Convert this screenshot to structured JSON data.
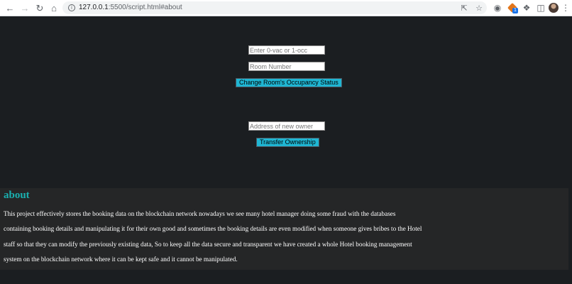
{
  "browser": {
    "url_host": "127.0.0.1",
    "url_rest": ":5500/script.html#about",
    "extension_badge": "1"
  },
  "occupancy_form": {
    "status_placeholder": "Enter 0-vac or 1-occ",
    "room_placeholder": "Room Number",
    "submit_label": "Change Room's Occupancy Status"
  },
  "ownership_form": {
    "address_placeholder": "Address of new owner",
    "submit_label": "Transfer Ownership"
  },
  "about": {
    "heading": "about",
    "text": "This project effectively stores the booking data on the blockchain network nowadays we see many hotel manager doing some fraud with the databases containing booking details and manipulating it for their own good and sometimes the booking details are even modified when someone gives bribes to the Hotel staff so that they can modify the previously existing data, So to keep all the data secure and transparent we have created a whole Hotel booking management system on the blockchain network where it can be kept safe and it cannot be manipulated."
  },
  "colors": {
    "page_background": "#1b1e21",
    "button": "#1fb6d3",
    "about_background": "#252627",
    "about_heading": "#1ab0b0"
  },
  "icons": [
    "back-arrow-icon",
    "forward-arrow-icon",
    "reload-icon",
    "home-icon",
    "info-icon",
    "share-icon",
    "star-icon",
    "extension-icon",
    "metamask-fox-icon",
    "puzzle-icon",
    "sidebar-icon",
    "avatar",
    "menu-icon"
  ]
}
